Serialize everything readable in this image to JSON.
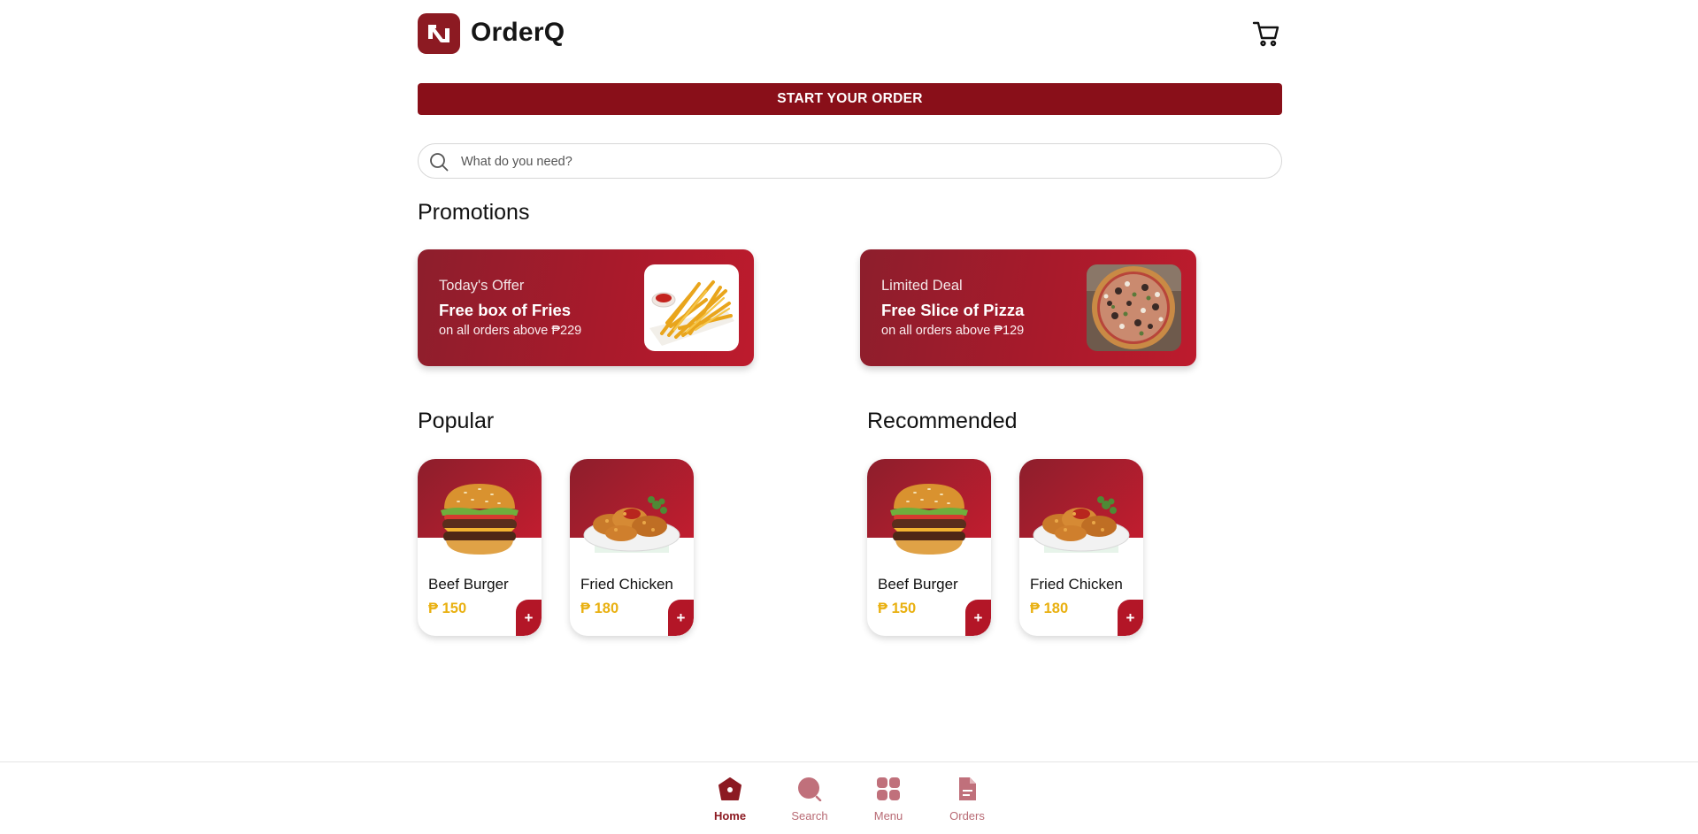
{
  "header": {
    "brand": "OrderQ",
    "logo_icon": "orderq-logo-icon",
    "cart_icon": "cart-icon"
  },
  "start_order": {
    "label": "START YOUR ORDER"
  },
  "search": {
    "placeholder": "What do you need?",
    "value": ""
  },
  "promotions": {
    "title": "Promotions",
    "items": [
      {
        "kicker": "Today's Offer",
        "headline": "Free box of Fries",
        "sub": "on all orders above ₱229",
        "image": "fries"
      },
      {
        "kicker": "Limited Deal",
        "headline": "Free Slice of Pizza",
        "sub": "on all orders above ₱129",
        "image": "pizza"
      }
    ]
  },
  "popular": {
    "title": "Popular",
    "items": [
      {
        "name": "Beef Burger",
        "price": "₱ 150",
        "image": "burger",
        "add": "+"
      },
      {
        "name": "Fried Chicken",
        "price": "₱ 180",
        "image": "chicken",
        "add": "+"
      }
    ]
  },
  "recommended": {
    "title": "Recommended",
    "items": [
      {
        "name": "Beef Burger",
        "price": "₱ 150",
        "image": "burger",
        "add": "+"
      },
      {
        "name": "Fried Chicken",
        "price": "₱ 180",
        "image": "chicken",
        "add": "+"
      }
    ]
  },
  "bottom_nav": {
    "items": [
      {
        "label": "Home",
        "icon": "home-icon",
        "active": true
      },
      {
        "label": "Search",
        "icon": "search-icon",
        "active": false
      },
      {
        "label": "Menu",
        "icon": "menu-grid-icon",
        "active": false
      },
      {
        "label": "Orders",
        "icon": "orders-document-icon",
        "active": false
      }
    ]
  },
  "colors": {
    "brand_dark": "#890f19",
    "brand": "#b31627",
    "price": "#e9b010",
    "nav_inactive": "#b86a74"
  }
}
